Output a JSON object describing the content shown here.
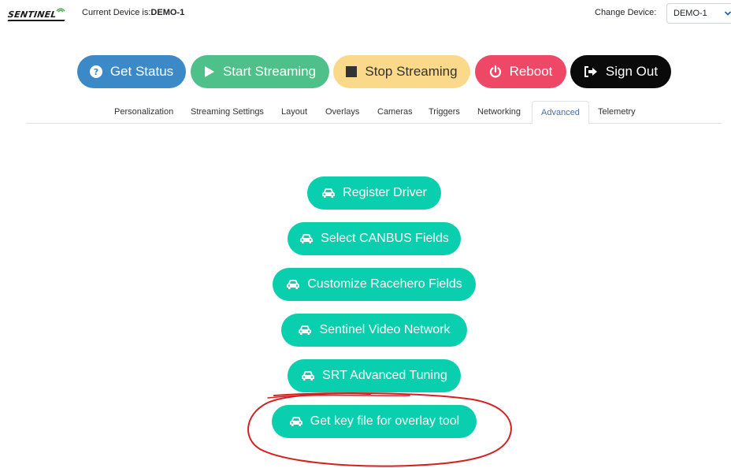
{
  "header": {
    "logo_text": "SENTINEL",
    "current_device_label": "Current Device is:",
    "current_device_value": "DEMO-1",
    "change_device_label": "Change Device:",
    "device_select_value": "DEMO-1"
  },
  "actions": {
    "get_status": "Get Status",
    "start_streaming": "Start Streaming",
    "stop_streaming": "Stop Streaming",
    "reboot": "Reboot",
    "sign_out": "Sign Out"
  },
  "tabs": [
    {
      "label": "Personalization"
    },
    {
      "label": "Streaming Settings"
    },
    {
      "label": "Layout"
    },
    {
      "label": "Overlays"
    },
    {
      "label": "Cameras"
    },
    {
      "label": "Triggers"
    },
    {
      "label": "Networking"
    },
    {
      "label": "Advanced",
      "active": true
    },
    {
      "label": "Telemetry"
    }
  ],
  "advanced": {
    "buttons": [
      {
        "label": "Register Driver",
        "icon": "car-icon"
      },
      {
        "label": "Select CANBUS Fields",
        "icon": "car-icon"
      },
      {
        "label": "Customize Racehero Fields",
        "icon": "car-icon"
      },
      {
        "label": "Sentinel Video Network",
        "icon": "car-icon"
      },
      {
        "label": "SRT Advanced Tuning",
        "icon": "car-icon"
      },
      {
        "label": "Get key file for overlay tool",
        "icon": "car-icon"
      }
    ]
  },
  "colors": {
    "status": "#3c89c8",
    "start": "#4ec18a",
    "stop": "#fbd98a",
    "reboot": "#ee4866",
    "signout": "#0a0a0a",
    "teal": "#0acfae",
    "annotation": "#d62020",
    "active_tab_text": "#4a6fa5"
  }
}
